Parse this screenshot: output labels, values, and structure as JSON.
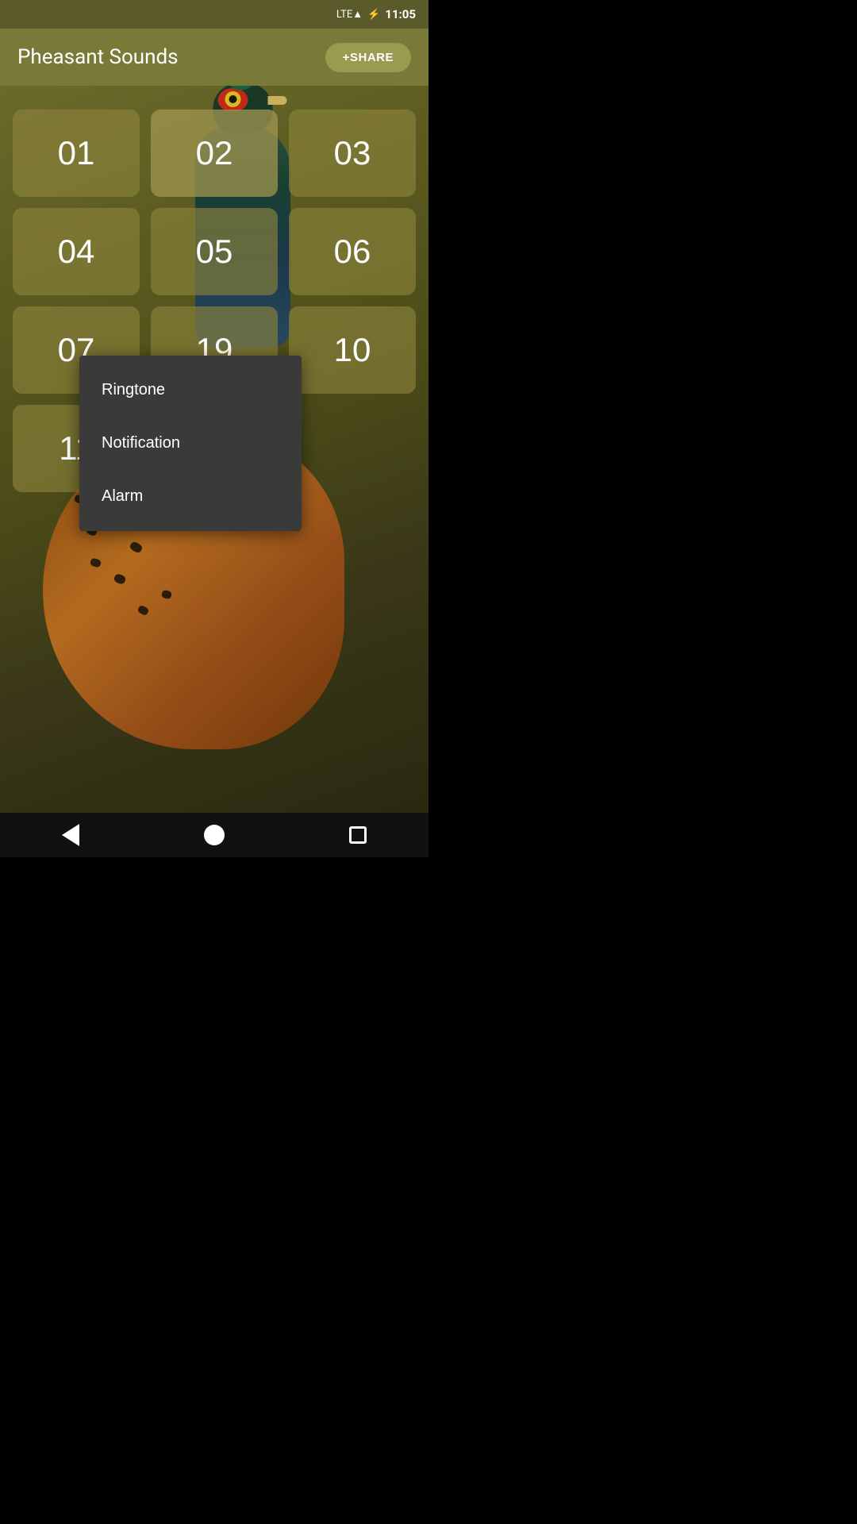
{
  "statusBar": {
    "time": "11:05",
    "batteryIcon": "🔋",
    "signalIcon": "LTE"
  },
  "header": {
    "title": "Pheasant Sounds",
    "shareButton": "+SHARE"
  },
  "sounds": [
    {
      "id": "01",
      "label": "01",
      "active": false
    },
    {
      "id": "02",
      "label": "02",
      "active": true
    },
    {
      "id": "03",
      "label": "03",
      "active": false
    },
    {
      "id": "04",
      "label": "04",
      "active": false
    },
    {
      "id": "05",
      "label": "05",
      "active": false
    },
    {
      "id": "06",
      "label": "06",
      "active": false
    },
    {
      "id": "07",
      "label": "07",
      "active": false
    },
    {
      "id": "19",
      "label": "19",
      "active": false
    },
    {
      "id": "10",
      "label": "10",
      "active": false
    },
    {
      "id": "11",
      "label": "11",
      "active": false
    }
  ],
  "contextMenu": {
    "items": [
      {
        "id": "ringtone",
        "label": "Ringtone"
      },
      {
        "id": "notification",
        "label": "Notification"
      },
      {
        "id": "alarm",
        "label": "Alarm"
      }
    ]
  },
  "navBar": {
    "backLabel": "back",
    "homeLabel": "home",
    "recentsLabel": "recents"
  }
}
